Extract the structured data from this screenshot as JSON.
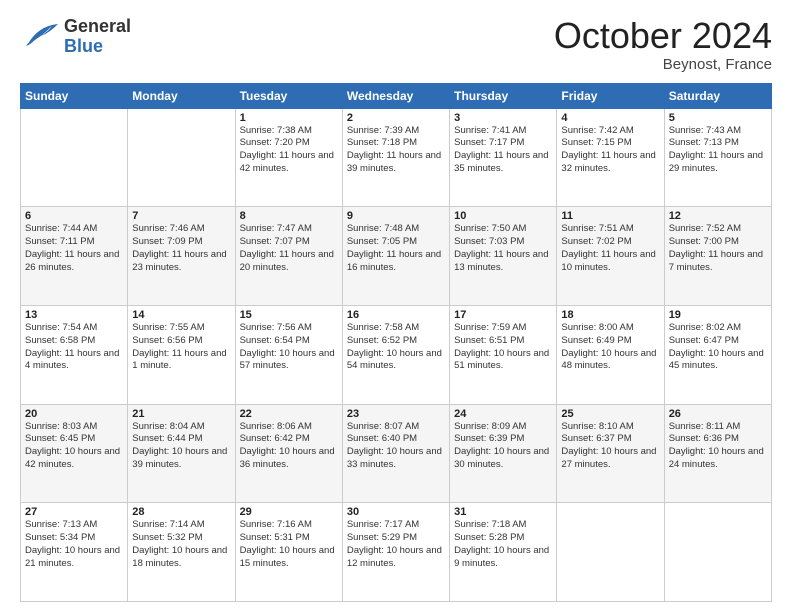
{
  "header": {
    "logo_general": "General",
    "logo_blue": "Blue",
    "month_title": "October 2024",
    "location": "Beynost, France"
  },
  "days_header": [
    "Sunday",
    "Monday",
    "Tuesday",
    "Wednesday",
    "Thursday",
    "Friday",
    "Saturday"
  ],
  "weeks": [
    [
      {
        "day": "",
        "sunrise": "",
        "sunset": "",
        "daylight": ""
      },
      {
        "day": "",
        "sunrise": "",
        "sunset": "",
        "daylight": ""
      },
      {
        "day": "1",
        "sunrise": "Sunrise: 7:38 AM",
        "sunset": "Sunset: 7:20 PM",
        "daylight": "Daylight: 11 hours and 42 minutes."
      },
      {
        "day": "2",
        "sunrise": "Sunrise: 7:39 AM",
        "sunset": "Sunset: 7:18 PM",
        "daylight": "Daylight: 11 hours and 39 minutes."
      },
      {
        "day": "3",
        "sunrise": "Sunrise: 7:41 AM",
        "sunset": "Sunset: 7:17 PM",
        "daylight": "Daylight: 11 hours and 35 minutes."
      },
      {
        "day": "4",
        "sunrise": "Sunrise: 7:42 AM",
        "sunset": "Sunset: 7:15 PM",
        "daylight": "Daylight: 11 hours and 32 minutes."
      },
      {
        "day": "5",
        "sunrise": "Sunrise: 7:43 AM",
        "sunset": "Sunset: 7:13 PM",
        "daylight": "Daylight: 11 hours and 29 minutes."
      }
    ],
    [
      {
        "day": "6",
        "sunrise": "Sunrise: 7:44 AM",
        "sunset": "Sunset: 7:11 PM",
        "daylight": "Daylight: 11 hours and 26 minutes."
      },
      {
        "day": "7",
        "sunrise": "Sunrise: 7:46 AM",
        "sunset": "Sunset: 7:09 PM",
        "daylight": "Daylight: 11 hours and 23 minutes."
      },
      {
        "day": "8",
        "sunrise": "Sunrise: 7:47 AM",
        "sunset": "Sunset: 7:07 PM",
        "daylight": "Daylight: 11 hours and 20 minutes."
      },
      {
        "day": "9",
        "sunrise": "Sunrise: 7:48 AM",
        "sunset": "Sunset: 7:05 PM",
        "daylight": "Daylight: 11 hours and 16 minutes."
      },
      {
        "day": "10",
        "sunrise": "Sunrise: 7:50 AM",
        "sunset": "Sunset: 7:03 PM",
        "daylight": "Daylight: 11 hours and 13 minutes."
      },
      {
        "day": "11",
        "sunrise": "Sunrise: 7:51 AM",
        "sunset": "Sunset: 7:02 PM",
        "daylight": "Daylight: 11 hours and 10 minutes."
      },
      {
        "day": "12",
        "sunrise": "Sunrise: 7:52 AM",
        "sunset": "Sunset: 7:00 PM",
        "daylight": "Daylight: 11 hours and 7 minutes."
      }
    ],
    [
      {
        "day": "13",
        "sunrise": "Sunrise: 7:54 AM",
        "sunset": "Sunset: 6:58 PM",
        "daylight": "Daylight: 11 hours and 4 minutes."
      },
      {
        "day": "14",
        "sunrise": "Sunrise: 7:55 AM",
        "sunset": "Sunset: 6:56 PM",
        "daylight": "Daylight: 11 hours and 1 minute."
      },
      {
        "day": "15",
        "sunrise": "Sunrise: 7:56 AM",
        "sunset": "Sunset: 6:54 PM",
        "daylight": "Daylight: 10 hours and 57 minutes."
      },
      {
        "day": "16",
        "sunrise": "Sunrise: 7:58 AM",
        "sunset": "Sunset: 6:52 PM",
        "daylight": "Daylight: 10 hours and 54 minutes."
      },
      {
        "day": "17",
        "sunrise": "Sunrise: 7:59 AM",
        "sunset": "Sunset: 6:51 PM",
        "daylight": "Daylight: 10 hours and 51 minutes."
      },
      {
        "day": "18",
        "sunrise": "Sunrise: 8:00 AM",
        "sunset": "Sunset: 6:49 PM",
        "daylight": "Daylight: 10 hours and 48 minutes."
      },
      {
        "day": "19",
        "sunrise": "Sunrise: 8:02 AM",
        "sunset": "Sunset: 6:47 PM",
        "daylight": "Daylight: 10 hours and 45 minutes."
      }
    ],
    [
      {
        "day": "20",
        "sunrise": "Sunrise: 8:03 AM",
        "sunset": "Sunset: 6:45 PM",
        "daylight": "Daylight: 10 hours and 42 minutes."
      },
      {
        "day": "21",
        "sunrise": "Sunrise: 8:04 AM",
        "sunset": "Sunset: 6:44 PM",
        "daylight": "Daylight: 10 hours and 39 minutes."
      },
      {
        "day": "22",
        "sunrise": "Sunrise: 8:06 AM",
        "sunset": "Sunset: 6:42 PM",
        "daylight": "Daylight: 10 hours and 36 minutes."
      },
      {
        "day": "23",
        "sunrise": "Sunrise: 8:07 AM",
        "sunset": "Sunset: 6:40 PM",
        "daylight": "Daylight: 10 hours and 33 minutes."
      },
      {
        "day": "24",
        "sunrise": "Sunrise: 8:09 AM",
        "sunset": "Sunset: 6:39 PM",
        "daylight": "Daylight: 10 hours and 30 minutes."
      },
      {
        "day": "25",
        "sunrise": "Sunrise: 8:10 AM",
        "sunset": "Sunset: 6:37 PM",
        "daylight": "Daylight: 10 hours and 27 minutes."
      },
      {
        "day": "26",
        "sunrise": "Sunrise: 8:11 AM",
        "sunset": "Sunset: 6:36 PM",
        "daylight": "Daylight: 10 hours and 24 minutes."
      }
    ],
    [
      {
        "day": "27",
        "sunrise": "Sunrise: 7:13 AM",
        "sunset": "Sunset: 5:34 PM",
        "daylight": "Daylight: 10 hours and 21 minutes."
      },
      {
        "day": "28",
        "sunrise": "Sunrise: 7:14 AM",
        "sunset": "Sunset: 5:32 PM",
        "daylight": "Daylight: 10 hours and 18 minutes."
      },
      {
        "day": "29",
        "sunrise": "Sunrise: 7:16 AM",
        "sunset": "Sunset: 5:31 PM",
        "daylight": "Daylight: 10 hours and 15 minutes."
      },
      {
        "day": "30",
        "sunrise": "Sunrise: 7:17 AM",
        "sunset": "Sunset: 5:29 PM",
        "daylight": "Daylight: 10 hours and 12 minutes."
      },
      {
        "day": "31",
        "sunrise": "Sunrise: 7:18 AM",
        "sunset": "Sunset: 5:28 PM",
        "daylight": "Daylight: 10 hours and 9 minutes."
      },
      {
        "day": "",
        "sunrise": "",
        "sunset": "",
        "daylight": ""
      },
      {
        "day": "",
        "sunrise": "",
        "sunset": "",
        "daylight": ""
      }
    ]
  ]
}
